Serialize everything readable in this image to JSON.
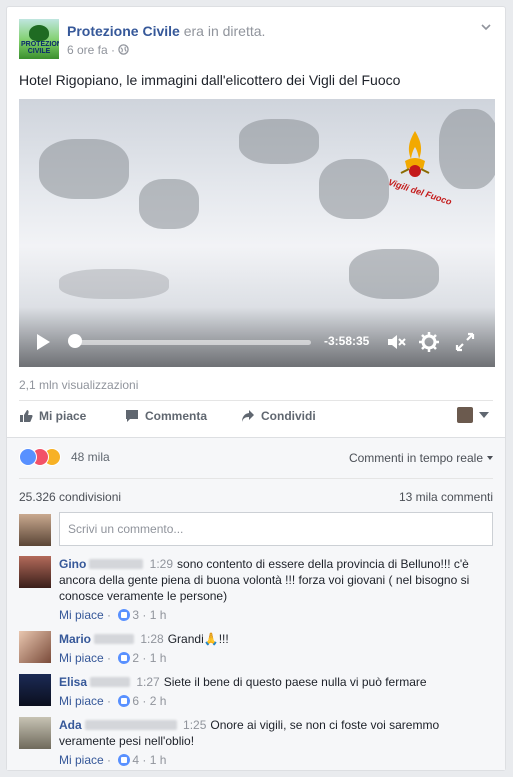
{
  "post": {
    "page_name": "Protezione Civile",
    "live_status": "era in diretta.",
    "timestamp": "6 ore fa",
    "visibility_icon": "globe-icon",
    "avatar_text": "PROTEZIONE CIVILE",
    "text": "Hotel Rigopiano, le immagini dall'elicottero dei Vigli del Fuoco"
  },
  "video": {
    "watermark": "Vigili del Fuoco",
    "time_remaining": "-3:58:35",
    "progress_fraction": 0.0
  },
  "stats": {
    "views": "2,1 mln visualizzazioni",
    "reactions_count": "48 mila",
    "shares": "25.326 condivisioni",
    "comments_count": "13 mila commenti"
  },
  "actions": {
    "like": "Mi piace",
    "comment": "Commenta",
    "share": "Condividi"
  },
  "comments_header": {
    "sort_label": "Commenti in tempo reale"
  },
  "composer": {
    "placeholder": "Scrivi un commento..."
  },
  "comments": [
    {
      "name": "Gino",
      "time": "1:29",
      "text": "sono contento di essere della provincia di Belluno!!! c'è ancora della gente piena di buona volontà !!! forza voi giovani ( nel bisogno si conosce veramente le persone)",
      "like_label": "Mi piace",
      "likes": "3",
      "age": "1 h"
    },
    {
      "name": "Mario",
      "time": "1:28",
      "text": "Grandi",
      "emoji": "🙏",
      "text_after": "!!!",
      "like_label": "Mi piace",
      "likes": "2",
      "age": "1 h"
    },
    {
      "name": "Elisa",
      "time": "1:27",
      "text": "Siete il bene di questo paese nulla vi può fermare",
      "like_label": "Mi piace",
      "likes": "6",
      "age": "2 h"
    },
    {
      "name": "Ada",
      "time": "1:25",
      "text": "Onore ai vigili, se non ci foste voi saremmo veramente pesi nell'oblio!",
      "like_label": "Mi piace",
      "likes": "4",
      "age": "1 h"
    }
  ],
  "colors": {
    "link_blue": "#365899",
    "meta_gray": "#90949c",
    "like_blue": "#5890ff",
    "love_red": "#f25268",
    "sad_yellow": "#f7b125"
  }
}
